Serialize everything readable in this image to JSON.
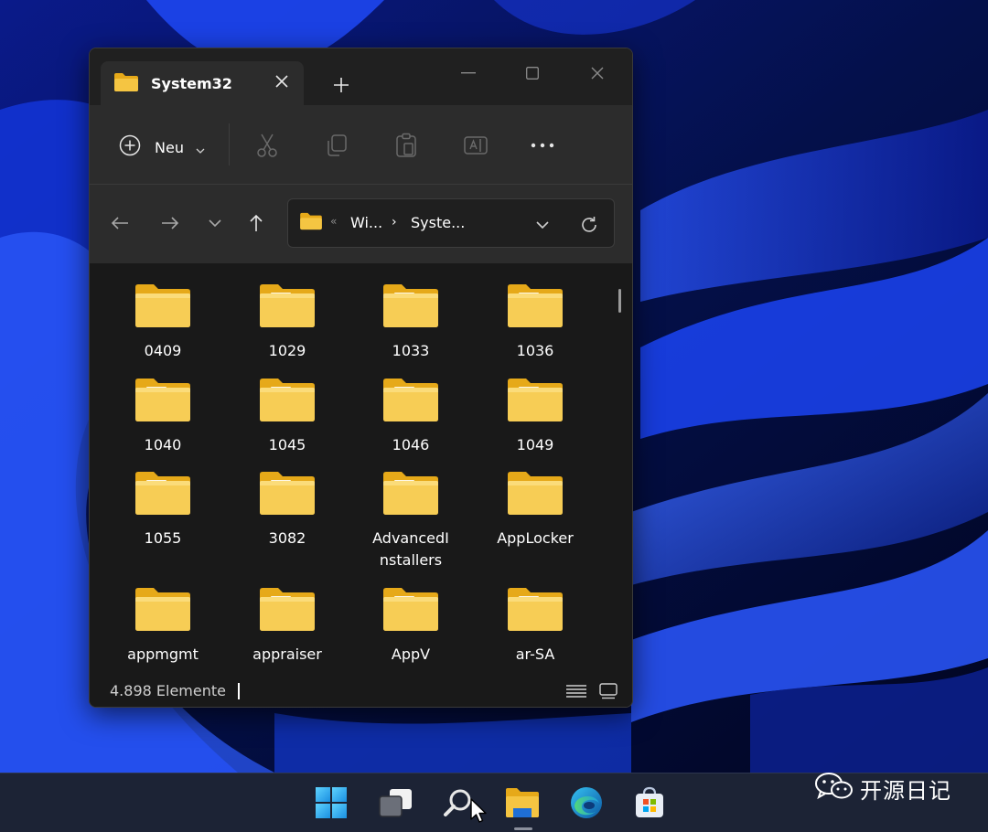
{
  "window": {
    "tab_title": "System32",
    "new_tab_symbol": "+",
    "toolbar": {
      "new_label": "Neu",
      "icons": [
        "cut-icon",
        "copy-icon",
        "paste-icon",
        "rename-icon",
        "more-icon"
      ]
    },
    "address": {
      "overflow_symbol": "«",
      "crumbs": [
        "Wi...",
        "Syste..."
      ],
      "separator": "›"
    },
    "folders": [
      {
        "name": "0409",
        "icon": "folder-plain"
      },
      {
        "name": "1029",
        "icon": "folder-content"
      },
      {
        "name": "1033",
        "icon": "folder-content"
      },
      {
        "name": "1036",
        "icon": "folder-content"
      },
      {
        "name": "1040",
        "icon": "folder-content"
      },
      {
        "name": "1045",
        "icon": "folder-content"
      },
      {
        "name": "1046",
        "icon": "folder-content"
      },
      {
        "name": "1049",
        "icon": "folder-content"
      },
      {
        "name": "1055",
        "icon": "folder-content"
      },
      {
        "name": "3082",
        "icon": "folder-content"
      },
      {
        "name": "AdvancedI",
        "name2": "nstallers",
        "icon": "folder-content"
      },
      {
        "name": "AppLocker",
        "icon": "folder-plain"
      },
      {
        "name": "appmgmt",
        "icon": "folder-plain"
      },
      {
        "name": "appraiser",
        "icon": "folder-content"
      },
      {
        "name": "AppV",
        "icon": "folder-content"
      },
      {
        "name": "ar-SA",
        "icon": "folder-content"
      }
    ],
    "status": {
      "item_count": "4.898 Elemente"
    }
  },
  "taskbar": {
    "apps": [
      "windows-start-icon",
      "task-view-icon",
      "search-icon",
      "file-explorer-icon",
      "edge-icon",
      "store-icon"
    ]
  },
  "watermark": {
    "text": "开源日记"
  },
  "colors": {
    "folder": "#f5c542",
    "folder_back": "#e6a919",
    "window_bg": "#191919",
    "toolbar_bg": "#2c2c2c",
    "taskbar_bg": "#1c2335",
    "accent_blue": "#1f4cff"
  }
}
